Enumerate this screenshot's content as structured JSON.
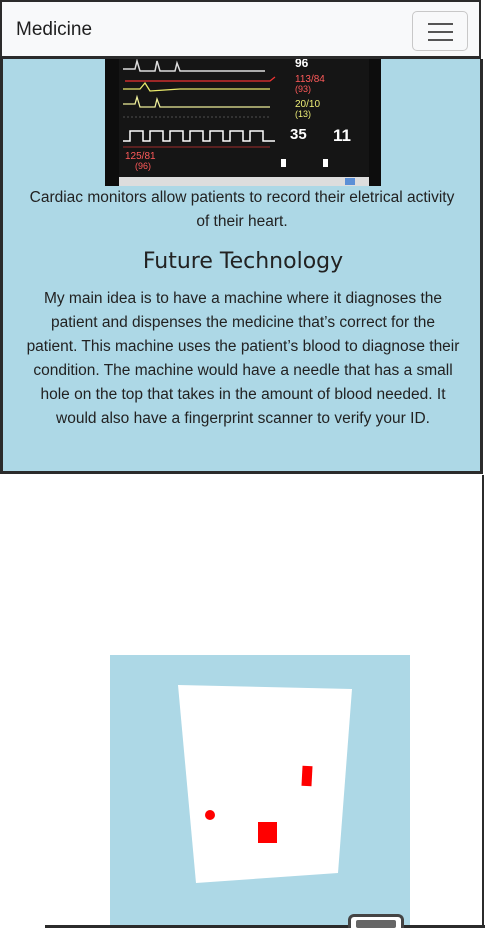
{
  "navbar": {
    "brand": "Medicine",
    "toggle_icon": "hamburger-menu-icon"
  },
  "monitor": {
    "readings": {
      "top": "96",
      "bp_1": "113/84",
      "bp_1_mean": "(93)",
      "pap": "20/10",
      "pap_mean": "(13)",
      "etco2": "35",
      "rr": "11",
      "art": "125/81",
      "art_mean": "(96)"
    }
  },
  "content": {
    "caption": "Cardiac monitors allow patients to record their eletrical activity of their heart.",
    "heading": "Future Technology",
    "paragraph": "My main idea is to have a machine where it diagnoses the patient and dispenses the medicine that’s correct for the patient. This machine uses the patient’s blood to diagnose their condition. The machine would have a needle that has a small hole on the top that takes in the amount of blood needed. It would also have a fingerprint scanner to verify your ID."
  },
  "colors": {
    "panel": "#add8e6",
    "border": "#2b2b2b",
    "marker": "#ff0000"
  }
}
